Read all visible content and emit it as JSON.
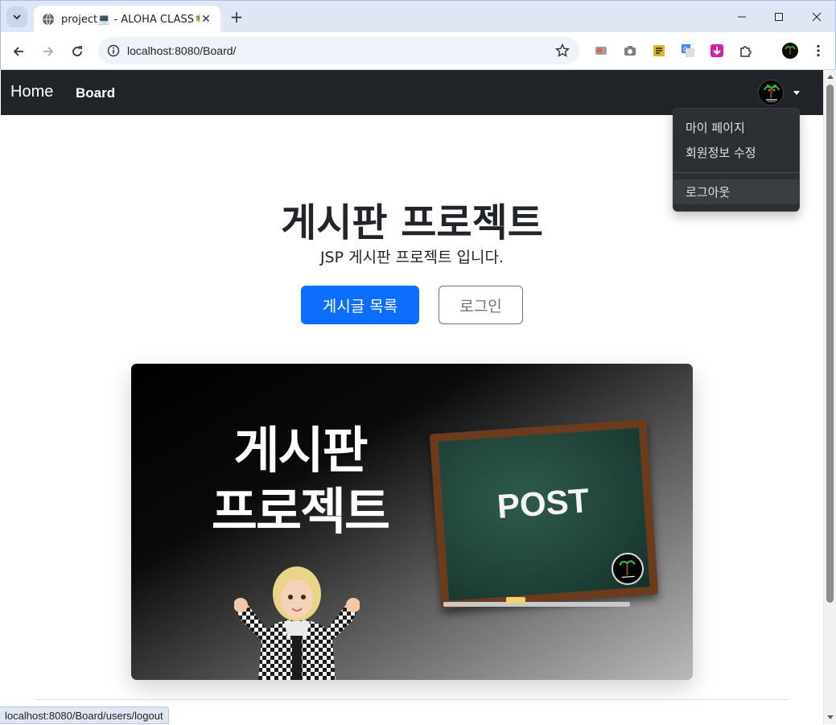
{
  "browser": {
    "tab": {
      "title": "project💻 - ALOHA CLASS🌴"
    },
    "address_bar": {
      "url": "localhost:8080/Board/"
    },
    "status_url": "localhost:8080/Board/users/logout"
  },
  "navbar": {
    "brand": "Home",
    "links": [
      {
        "label": "Board"
      }
    ]
  },
  "user_menu": {
    "items": [
      {
        "label": "마이 페이지"
      },
      {
        "label": "회원정보 수정"
      },
      {
        "label": "로그아웃"
      }
    ]
  },
  "hero": {
    "title": "게시판 프로젝트",
    "subtitle": "JSP 게시판 프로젝트 입니다.",
    "primary_button": "게시글 목록",
    "secondary_button": "로그인"
  },
  "banner": {
    "line1": "게시판",
    "line2": "프로젝트",
    "board_text": "POST"
  },
  "colors": {
    "navbar_bg": "#212529",
    "primary": "#0d6efd",
    "secondary": "#6c757d",
    "dropdown_bg": "#2b3035"
  }
}
